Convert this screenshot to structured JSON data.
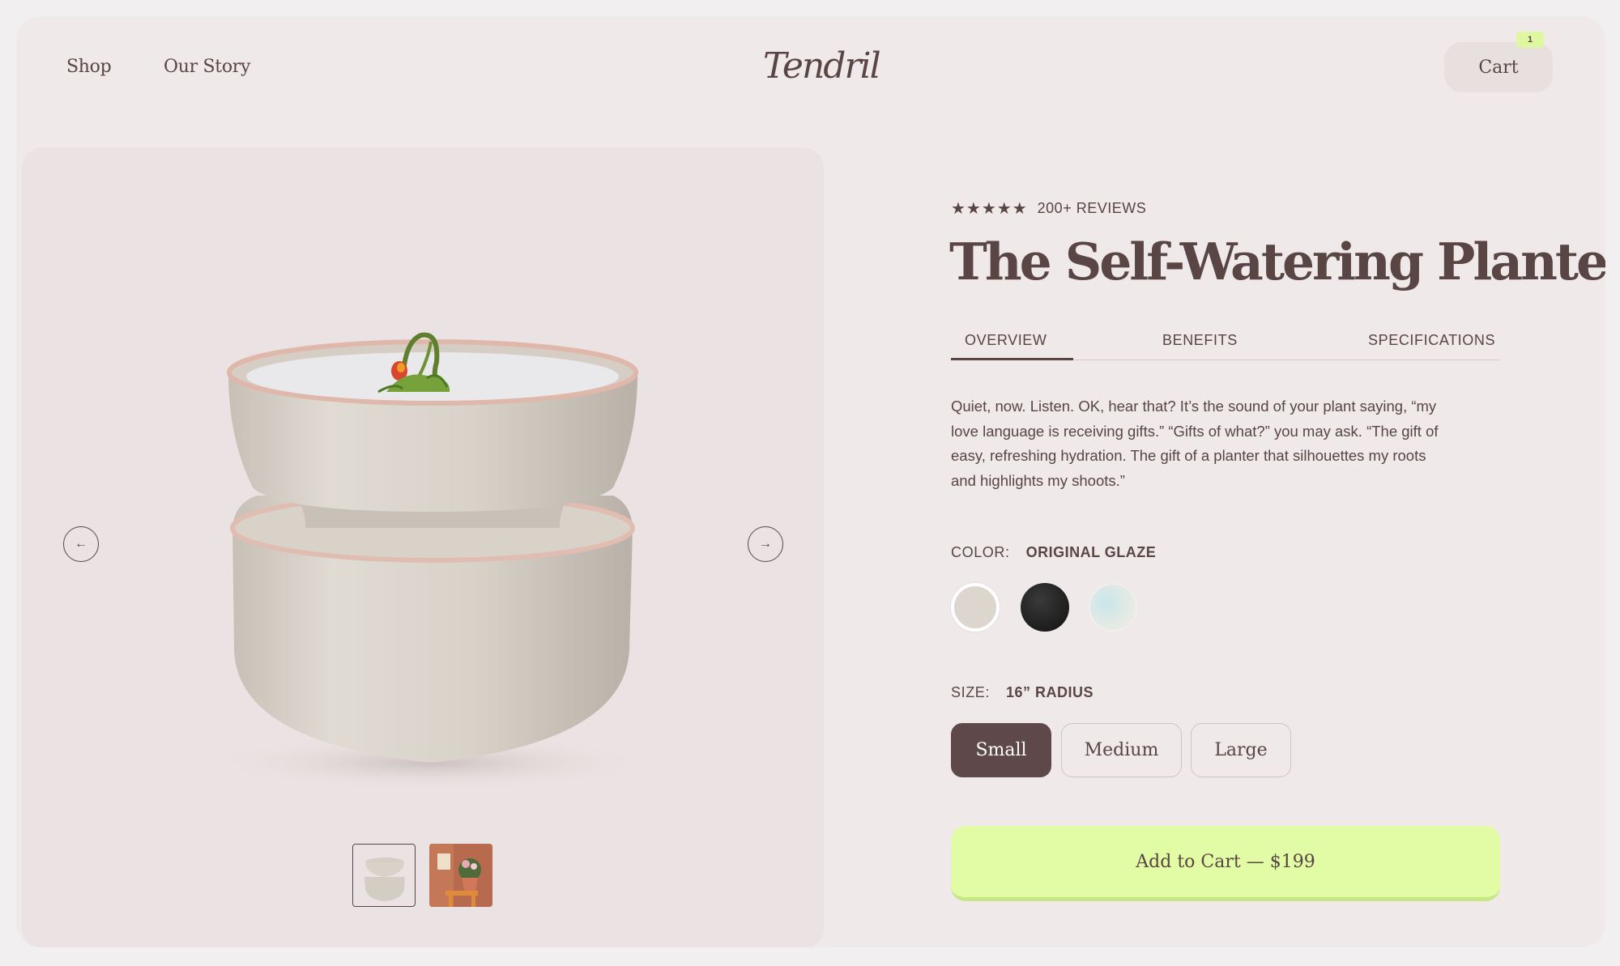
{
  "header": {
    "nav": [
      "Shop",
      "Our Story"
    ],
    "logo": "Tendril",
    "cart_label": "Cart",
    "cart_count": "1"
  },
  "gallery": {
    "prev_icon": "arrow-left-icon",
    "next_icon": "arrow-right-icon",
    "thumbnails": [
      "planter-thumbnail",
      "lifestyle-thumbnail"
    ]
  },
  "product": {
    "stars": "★★★★★",
    "reviews": "200+ REVIEWS",
    "title": "The Self-Watering Planter",
    "tabs": [
      "OVERVIEW",
      "BENEFITS",
      "SPECIFICATIONS"
    ],
    "active_tab": "OVERVIEW",
    "description": "Quiet, now. Listen. OK, hear that? It’s the sound of your plant saying, “my love language is receiving gifts.” “Gifts of what?” you may ask. “The gift of easy, refreshing hydration. The gift of a planter that silhouettes my roots and highlights my shoots.”",
    "color_label": "COLOR:",
    "color_value": "ORIGINAL GLAZE",
    "swatches": [
      "#dcd6cf",
      "#1f1f1f",
      "#cfe7ea"
    ],
    "size_label": "SIZE:",
    "size_value": "16” RADIUS",
    "sizes": [
      "Small",
      "Medium",
      "Large"
    ],
    "selected_size": "Small",
    "add_to_cart": "Add to Cart — $199"
  },
  "colors": {
    "accent": "#e1fca5",
    "text": "#5a4545",
    "selected_size_bg": "#5e4849"
  }
}
